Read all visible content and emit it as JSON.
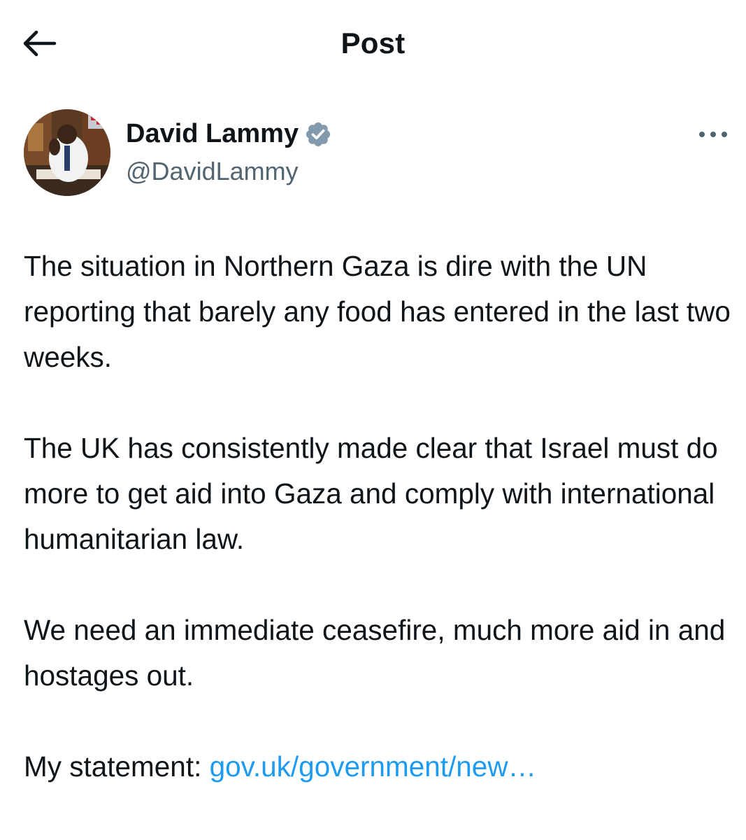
{
  "header": {
    "title": "Post",
    "back_icon": "arrow-left-icon"
  },
  "author": {
    "name": "David Lammy",
    "handle": "@DavidLammy",
    "verified": true,
    "verified_color": "#829aab"
  },
  "post": {
    "paragraphs": [
      "The situation in Northern Gaza is dire with the UN reporting that barely any food has entered in the last two weeks.",
      "The UK has consistently made clear that Israel must do more to get aid into Gaza and comply with international humanitarian law.",
      "We need an immediate ceasefire, much more aid in and hostages out."
    ],
    "statement_prefix": "My statement: ",
    "statement_link": "gov.uk/government/new…"
  },
  "colors": {
    "text": "#0f1419",
    "secondary": "#536471",
    "link": "#1d9bf0"
  }
}
